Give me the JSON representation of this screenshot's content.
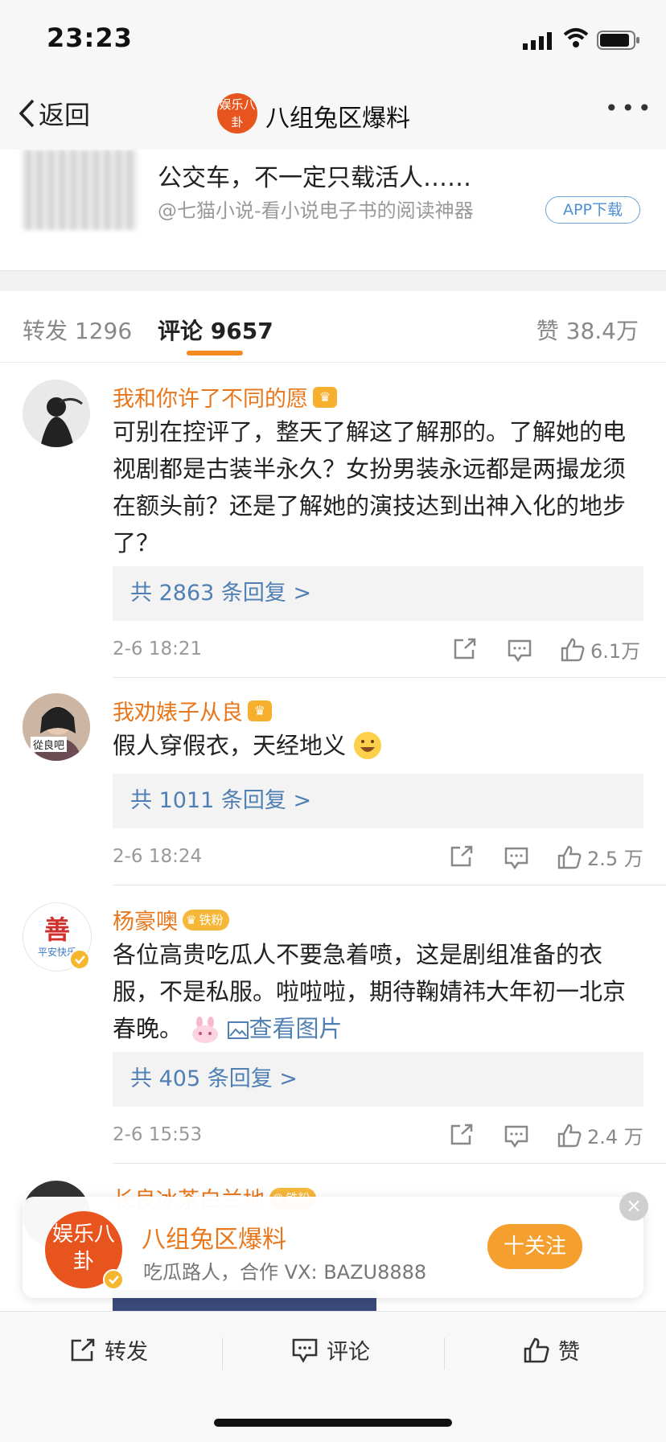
{
  "status": {
    "time": "23:23"
  },
  "nav": {
    "back_label": "返回",
    "avatar_text": "娱乐八卦",
    "title": "八组兔区爆料",
    "more": "•••"
  },
  "ad": {
    "text": "公交车，不一定只载活人……",
    "source": "@七猫小说-看小说电子书的阅读神器",
    "button": "APP下载"
  },
  "tabs": {
    "repost": "转发 1296",
    "comments": "评论 9657",
    "likes": "赞 38.4万"
  },
  "comments": [
    {
      "user": "我和你许了不同的愿",
      "text": "可别在控评了，整天了解这了解那的。了解她的电视剧都是古装半永久？女扮男装永远都是两撮龙须在额头前？还是了解她的演技达到出神入化的地步了？",
      "replies": "共 2863 条回复 >",
      "time": "2-6 18:21",
      "likes": "6.1万"
    },
    {
      "user": "我劝婊子从良",
      "avatar_text": "從良吧",
      "text": "假人穿假衣，天经地义",
      "replies": "共 1011 条回复 >",
      "time": "2-6 18:24",
      "likes": "2.5 万"
    },
    {
      "user": "杨豪噢",
      "badge": "铁粉",
      "avatar_text": "善",
      "avatar_sub": "平安快乐",
      "text": "各位高贵吃瓜人不要急着喷，这是剧组准备的衣服，不是私服。啦啦啦，期待鞠婧祎大年初一北京春晚。",
      "image_link": "查看图片",
      "replies": "共 405 条回复 >",
      "time": "2-6 15:53",
      "likes": "2.4 万"
    },
    {
      "user": "长良冰茶白兰地",
      "badge": "铁粉"
    }
  ],
  "follow_popup": {
    "avatar_text": "娱乐八卦",
    "name": "八组兔区爆料",
    "desc": "吃瓜路人，合作 VX: BAZU8888",
    "button": "十关注",
    "close": "×"
  },
  "bottom_bar": {
    "repost": "转发",
    "comment": "评论",
    "like": "赞"
  },
  "colors": {
    "accent": "#f59f2f",
    "username": "#e8771c",
    "link": "#4f7fb3"
  }
}
